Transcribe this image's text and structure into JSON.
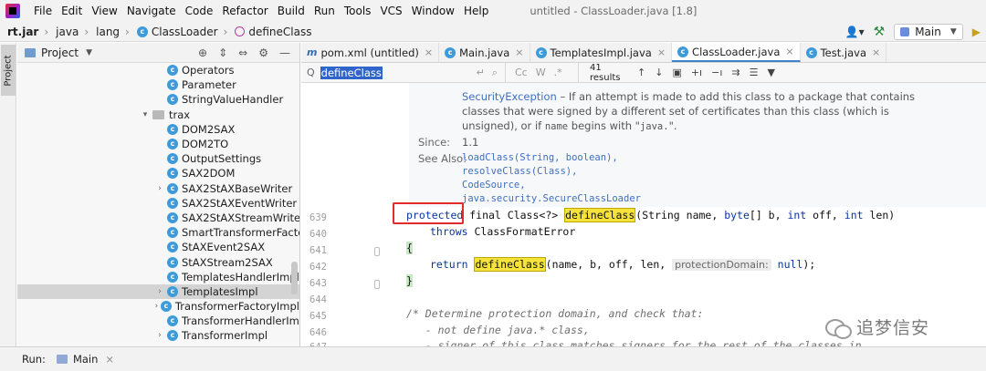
{
  "menu": {
    "items": [
      {
        "label": "File"
      },
      {
        "label": "Edit"
      },
      {
        "label": "View"
      },
      {
        "label": "Navigate"
      },
      {
        "label": "Code"
      },
      {
        "label": "Refactor"
      },
      {
        "label": "Build"
      },
      {
        "label": "Run"
      },
      {
        "label": "Tools"
      },
      {
        "label": "VCS"
      },
      {
        "label": "Window"
      },
      {
        "label": "Help"
      }
    ],
    "window_title": "untitled - ClassLoader.java [1.8]"
  },
  "breadcrumb": {
    "items": [
      "rt.jar",
      "java",
      "lang",
      "ClassLoader",
      "defineClass"
    ]
  },
  "toolbar": {
    "run_config": "Main"
  },
  "tool_window": {
    "project_tab": "Project"
  },
  "project_panel": {
    "title": "Project",
    "tree": [
      {
        "label": "Operators"
      },
      {
        "label": "Parameter"
      },
      {
        "label": "StringValueHandler"
      },
      {
        "label": "trax"
      },
      {
        "label": "DOM2SAX"
      },
      {
        "label": "DOM2TO"
      },
      {
        "label": "OutputSettings"
      },
      {
        "label": "SAX2DOM"
      },
      {
        "label": "SAX2StAXBaseWriter"
      },
      {
        "label": "SAX2StAXEventWriter"
      },
      {
        "label": "SAX2StAXStreamWriter"
      },
      {
        "label": "SmartTransformerFactoryIm"
      },
      {
        "label": "StAXEvent2SAX"
      },
      {
        "label": "StAXStream2SAX"
      },
      {
        "label": "TemplatesHandlerImpl"
      },
      {
        "label": "TemplatesImpl"
      },
      {
        "label": "TransformerFactoryImpl"
      },
      {
        "label": "TransformerHandlerImpl"
      },
      {
        "label": "TransformerImpl"
      }
    ]
  },
  "editor": {
    "tabs": [
      {
        "label": "pom.xml (untitled)"
      },
      {
        "label": "Main.java"
      },
      {
        "label": "TemplatesImpl.java"
      },
      {
        "label": "ClassLoader.java"
      },
      {
        "label": "Test.java"
      }
    ],
    "search": {
      "value": "defineClass",
      "results": "41 results"
    },
    "doc": {
      "exception": "SecurityException",
      "exception_text_1": " – If an attempt is made to add this class to a package that contains",
      "exception_text_2": "classes that were signed by a different set of certificates than this class (which is",
      "exception_text_3a": "unsigned), or if ",
      "exception_text_3b": "name",
      "exception_text_3c": " begins with \"",
      "exception_text_3d": "java.",
      "exception_text_3e": "\".",
      "since_label": "Since:",
      "since_value": "1.1",
      "see_also_label": "See Also:",
      "see_also": [
        "loadClass(String, boolean),",
        "resolveClass(Class),",
        "CodeSource,",
        "java.security.SecureClassLoader"
      ]
    },
    "line_numbers": [
      "639",
      "640",
      "641",
      "642",
      "643",
      "644",
      "645",
      "646",
      "647"
    ],
    "code": {
      "l639_kw": "protected",
      "l639_rest_a": " final Class<?> ",
      "l639_hl": "defineClass",
      "l639_rest_b": "(String name, ",
      "l639_byte": "byte",
      "l639_rest_c": "[] b, ",
      "l639_int1": "int",
      "l639_rest_d": " off, ",
      "l639_int2": "int",
      "l639_rest_e": " len)",
      "l640_kw": "throws",
      "l640_rest": " ClassFormatError",
      "l641": "{",
      "l642_kw": "return",
      "l642_hl": "defineClass",
      "l642_rest": "(name, b, off, len, ",
      "l642_hint": "protectionDomain:",
      "l642_null": "null",
      "l642_end": ");",
      "l643": "}",
      "l645": "/* Determine protection domain, and check that:",
      "l646": "   - not define java.* class,",
      "l647": "   - signer of this class matches signers for the rest of the classes in"
    }
  },
  "run_panel": {
    "label": "Run:",
    "tab": "Main"
  },
  "watermark": {
    "text": "追梦信安"
  }
}
